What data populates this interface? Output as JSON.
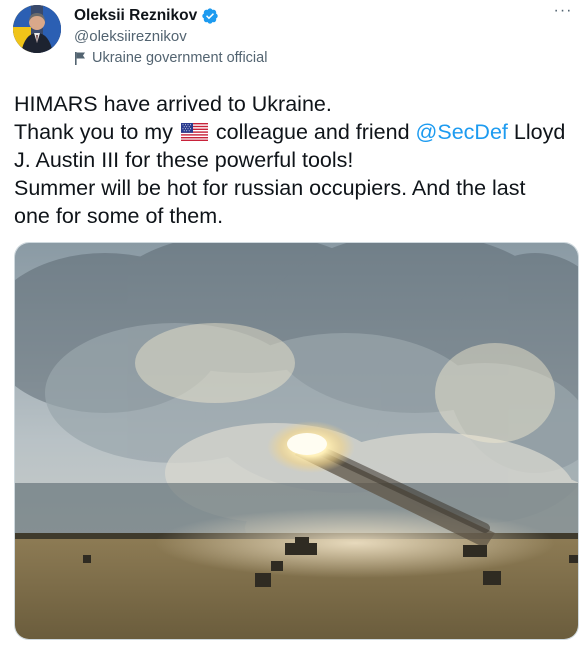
{
  "author": {
    "display_name": "Oleksii Reznikov",
    "handle": "@oleksiireznikov",
    "verified": true,
    "label": "Ukraine government official",
    "avatar_icon": "profile-photo"
  },
  "actions": {
    "more_label": "···"
  },
  "tweet": {
    "line1": "HIMARS have arrived to Ukraine.",
    "line2_prefix": "Thank you to my",
    "line2_flag_icon": "us-flag-emoji",
    "line2_middle": "colleague and friend",
    "line2_mention": "@SecDef",
    "line2_suffix": "Lloyd",
    "line3": "J. Austin III for these powerful tools!",
    "line4": "Summer will be hot for russian occupiers. And the last",
    "line5": "one for some of them."
  },
  "media": {
    "type": "photo",
    "icon": "rocket-launch-photo"
  },
  "colors": {
    "link": "#1d9bf0",
    "verified": "#1d9bf0",
    "secondary_text": "#536471",
    "primary_text": "#0f1419"
  }
}
